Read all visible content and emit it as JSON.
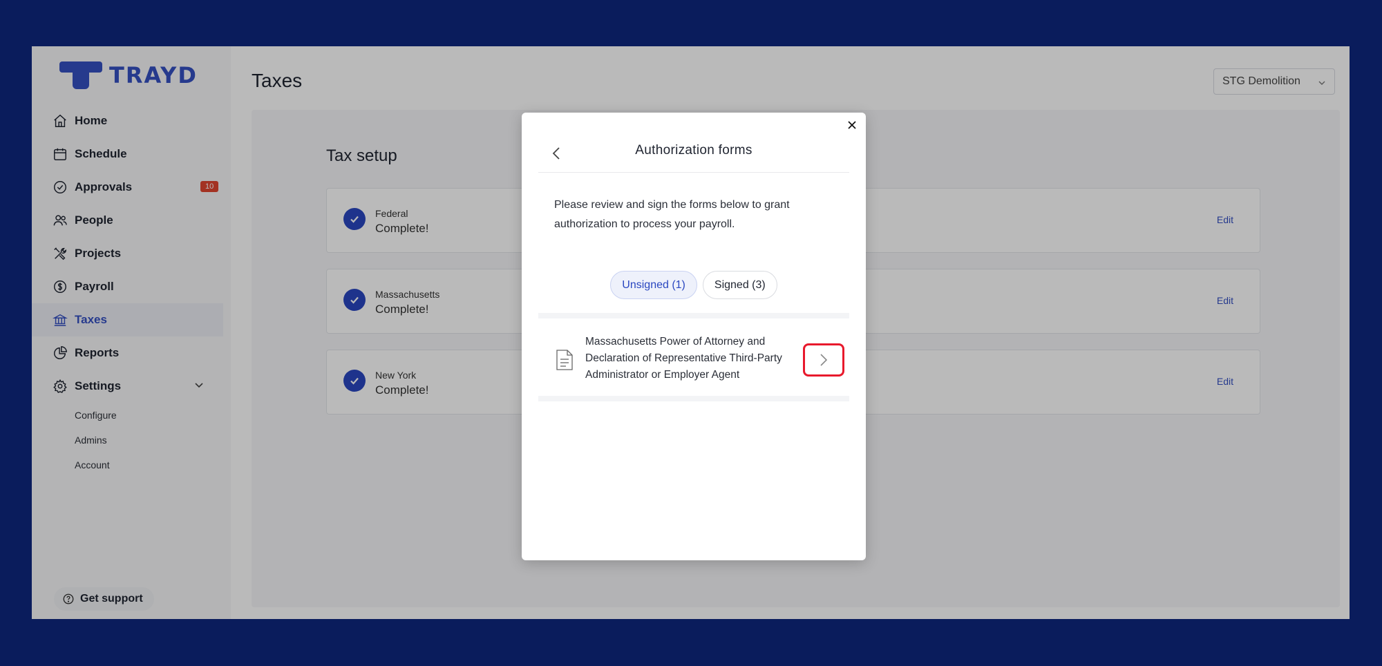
{
  "brand": {
    "name": "TRAYD",
    "accent": "#3550c2"
  },
  "sidebar": {
    "items": [
      {
        "label": "Home",
        "icon": "home-icon"
      },
      {
        "label": "Schedule",
        "icon": "calendar-icon"
      },
      {
        "label": "Approvals",
        "icon": "check-circle-icon",
        "badge": "10"
      },
      {
        "label": "People",
        "icon": "people-icon"
      },
      {
        "label": "Projects",
        "icon": "tools-icon"
      },
      {
        "label": "Payroll",
        "icon": "dollar-icon"
      },
      {
        "label": "Taxes",
        "icon": "bank-icon"
      },
      {
        "label": "Reports",
        "icon": "pie-chart-icon"
      },
      {
        "label": "Settings",
        "icon": "gear-icon"
      }
    ],
    "active": "Taxes",
    "settings_sub": [
      "Configure",
      "Admins",
      "Account"
    ],
    "support_label": "Get support"
  },
  "header": {
    "title": "Taxes",
    "company": "STG Demolition"
  },
  "tax_setup": {
    "title": "Tax setup",
    "rows": [
      {
        "name": "Federal",
        "status": "Complete!",
        "action": "Edit"
      },
      {
        "name": "Massachusetts",
        "status": "Complete!",
        "action": "Edit"
      },
      {
        "name": "New York",
        "status": "Complete!",
        "action": "Edit"
      }
    ]
  },
  "modal": {
    "title": "Authorization forms",
    "description": "Please review and sign the forms below to grant authorization to process your payroll.",
    "tabs": [
      {
        "label": "Unsigned (1)",
        "active": true
      },
      {
        "label": "Signed (3)",
        "active": false
      }
    ],
    "forms": [
      {
        "title": "Massachusetts Power of Attorney and Declaration of Representative Third-Party Administrator or Employer Agent"
      }
    ]
  }
}
